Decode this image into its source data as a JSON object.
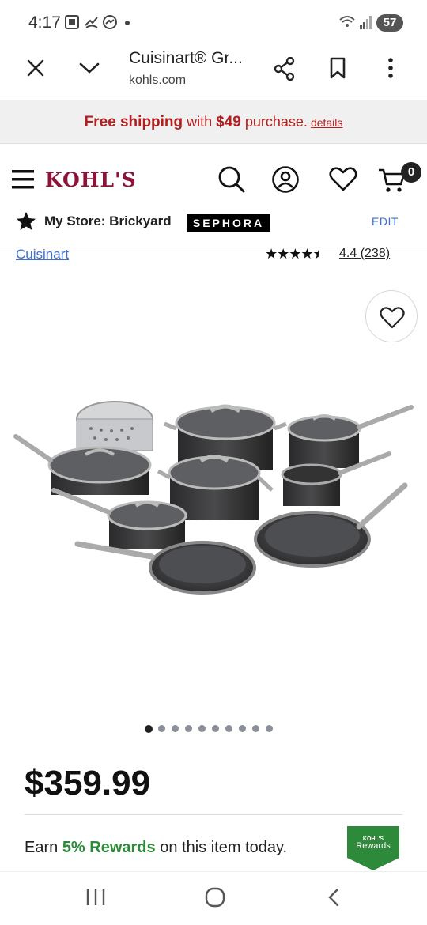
{
  "status_bar": {
    "time": "4:17",
    "battery": "57",
    "icons": [
      "screenshot-icon",
      "missed-call-icon",
      "messenger-icon",
      "dot-icon",
      "wifi-icon",
      "signal-icon"
    ]
  },
  "browser": {
    "title": "Cuisinart® Gr...",
    "url": "kohls.com",
    "icons": [
      "close-icon",
      "chevron-down-icon",
      "share-icon",
      "bookmark-icon",
      "more-vert-icon"
    ]
  },
  "promo": {
    "lead": "Free shipping",
    "middle": " with ",
    "amount": "$49",
    "tail": " purchase.",
    "link": "details"
  },
  "header": {
    "logo": "KOHL'S",
    "cart_count": "0",
    "store_label": "My Store: Brickyard",
    "sephora": "SEPHORA",
    "edit": "EDIT"
  },
  "product": {
    "brand": "Cuisinart",
    "stars": "★★★★",
    "rating": "4.4",
    "reviews": "(238)",
    "rating_value": 4.4,
    "price": "$359.99",
    "image_count": 10,
    "active_image": 0
  },
  "rewards": {
    "earn_prefix": "Earn ",
    "earn_bold": "5% Rewards",
    "earn_suffix": " on this item today.",
    "badge_top": "KOHL'S",
    "badge_bottom": "Rewards",
    "color": "#2e8a3b"
  },
  "colors": {
    "brand": "#8a1538",
    "promo_red": "#b41e1e",
    "link_blue": "#3a6fd8"
  }
}
